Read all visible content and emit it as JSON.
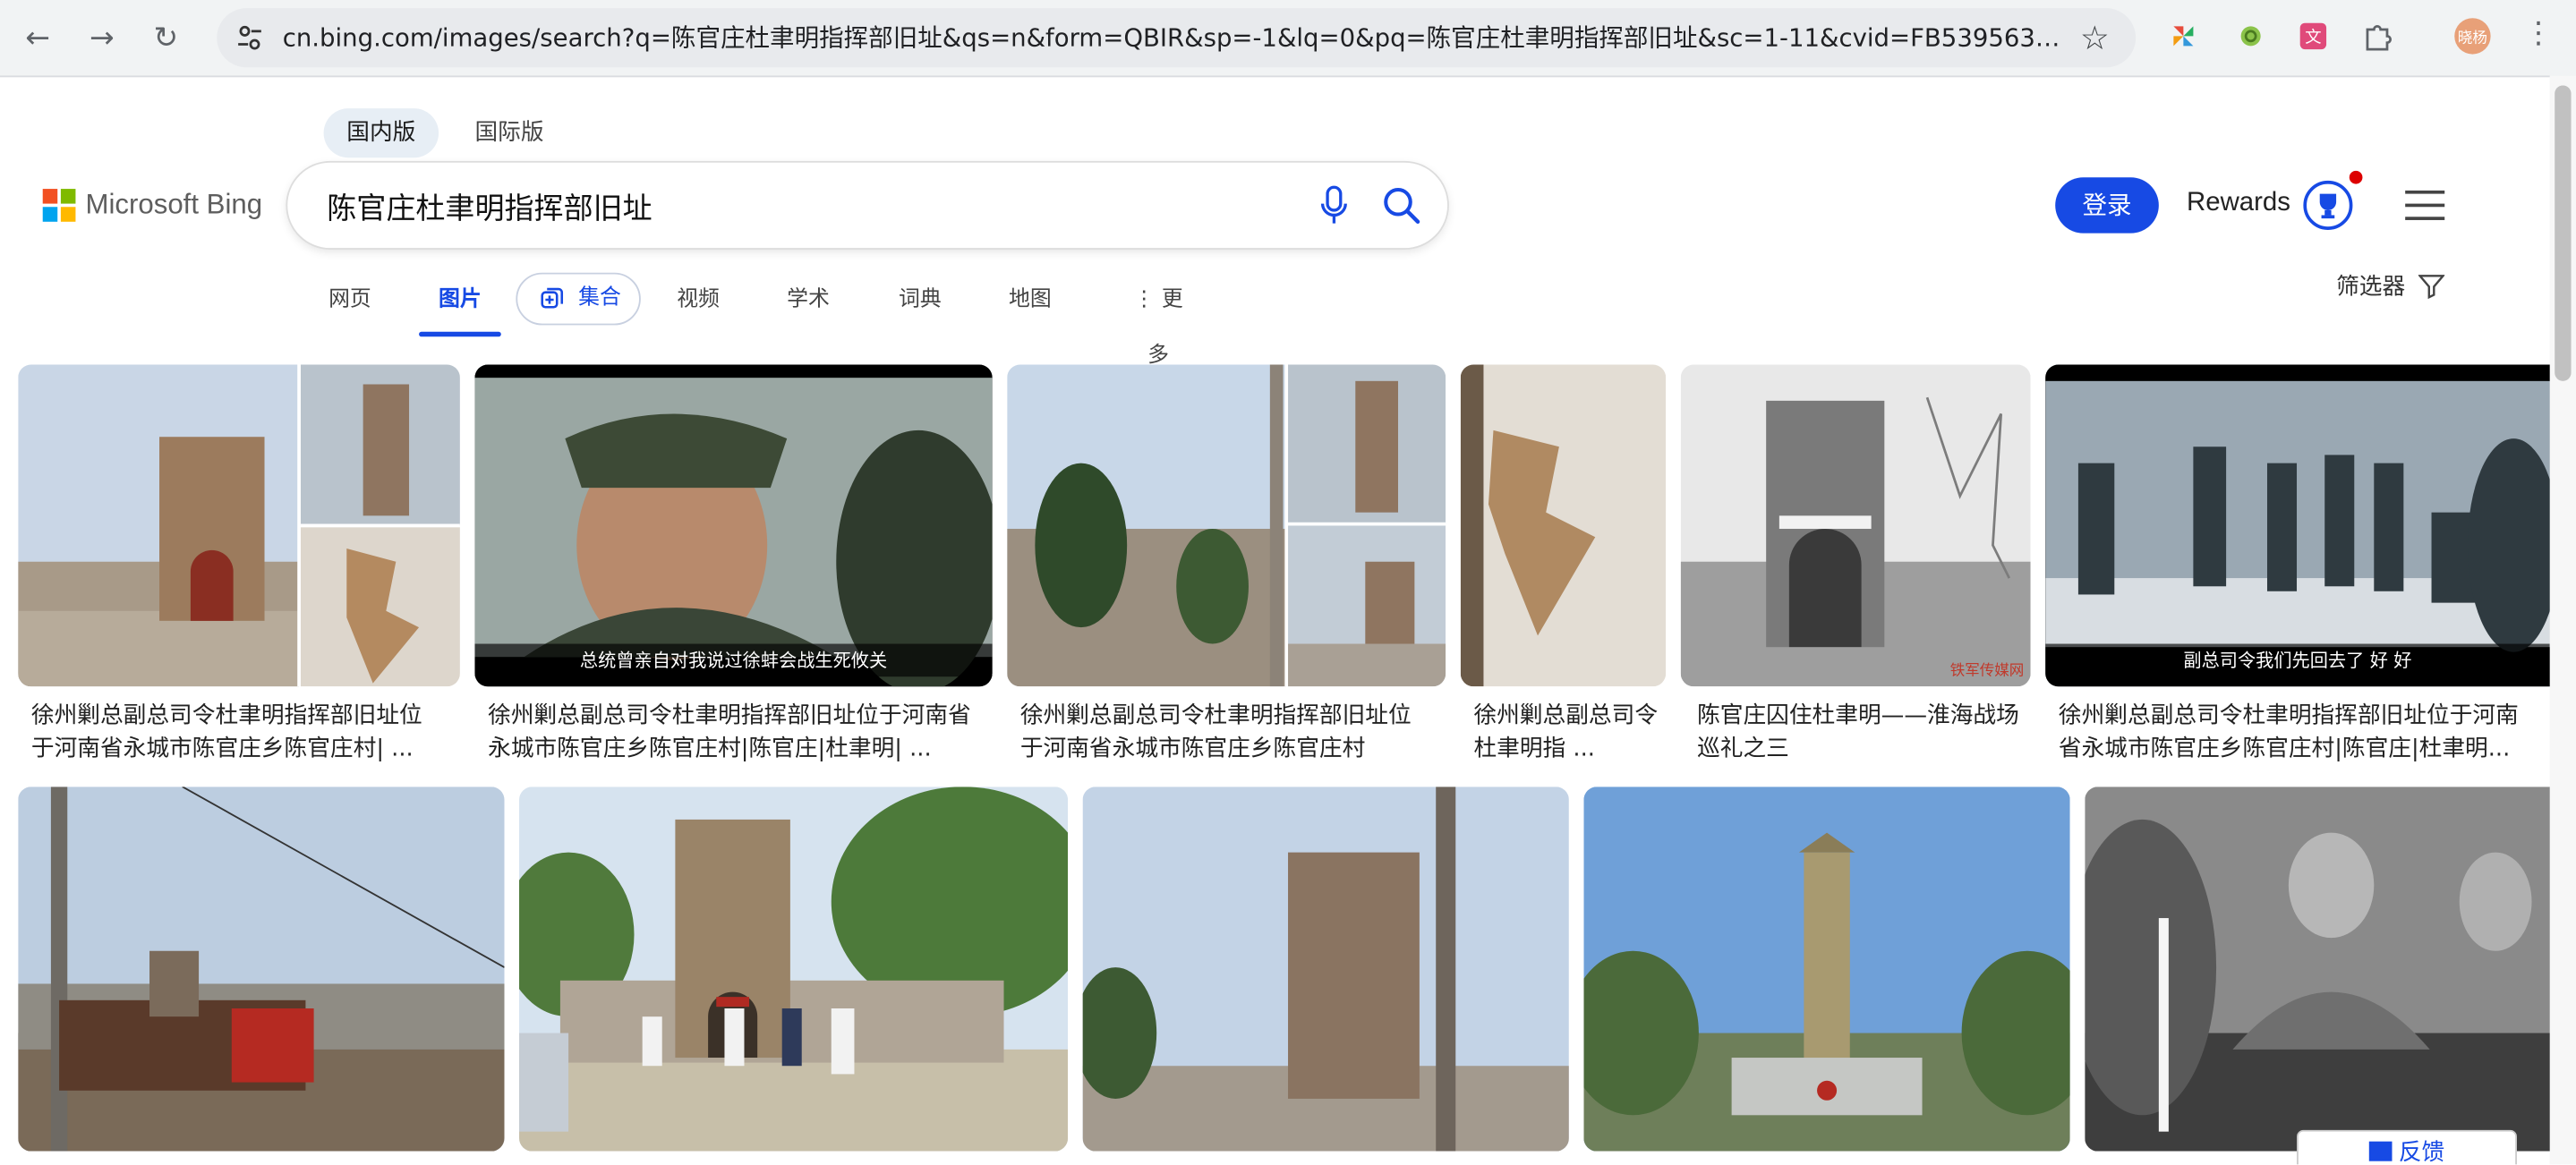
{
  "browser": {
    "url": "cn.bing.com/images/search?q=陈官庄杜聿明指挥部旧址&qs=n&form=QBIR&sp=-1&lq=0&pq=陈官庄杜聿明指挥部旧址&sc=1-11&cvid=FB53956333194...",
    "back_icon": "←",
    "forward_icon": "→",
    "reload_icon": "↻",
    "star_icon": "☆",
    "profile_label": "晓杨",
    "menu_icon": "⋮"
  },
  "bing": {
    "region_tabs": [
      "国内版",
      "国际版"
    ],
    "logo_text": "Microsoft Bing",
    "logo_colors": [
      "#f25022",
      "#7fba00",
      "#00a4ef",
      "#ffb900"
    ],
    "query": "陈官庄杜聿明指挥部旧址",
    "login_label": "登录",
    "rewards_label": "Rewards",
    "filter_label": "筛选器",
    "vertical_tabs": {
      "web": "网页",
      "images": "图片",
      "collections": "集合",
      "videos": "视频",
      "academic": "学术",
      "dictionary": "词典",
      "maps": "地图",
      "more": "更多"
    },
    "accent_color": "#174ae4"
  },
  "results": {
    "row1": [
      {
        "caption": "徐州剿总副总司令杜聿明指挥部旧址位于河南省永城市陈官庄乡陈官庄村| ..."
      },
      {
        "caption": "徐州剿总副总司令杜聿明指挥部旧址位于河南省永城市陈官庄乡陈官庄村|陈官庄|杜聿明| ...",
        "subtitle": "总统曾亲自对我说过徐蚌会战生死攸关"
      },
      {
        "caption": "徐州剿总副总司令杜聿明指挥部旧址位于河南省永城市陈官庄乡陈官庄村"
      },
      {
        "caption": "徐州剿总副总司令杜聿明指 ..."
      },
      {
        "caption": "陈官庄囚住杜聿明——淮海战场巡礼之三",
        "watermark": "铁军传媒网"
      },
      {
        "caption": "徐州剿总副总司令杜聿明指挥部旧址位于河南省永城市陈官庄乡陈官庄村|陈官庄|杜聿明...",
        "subtitle": "副总司令我们先回去了 好 好"
      }
    ]
  },
  "feedback_label": "反馈"
}
